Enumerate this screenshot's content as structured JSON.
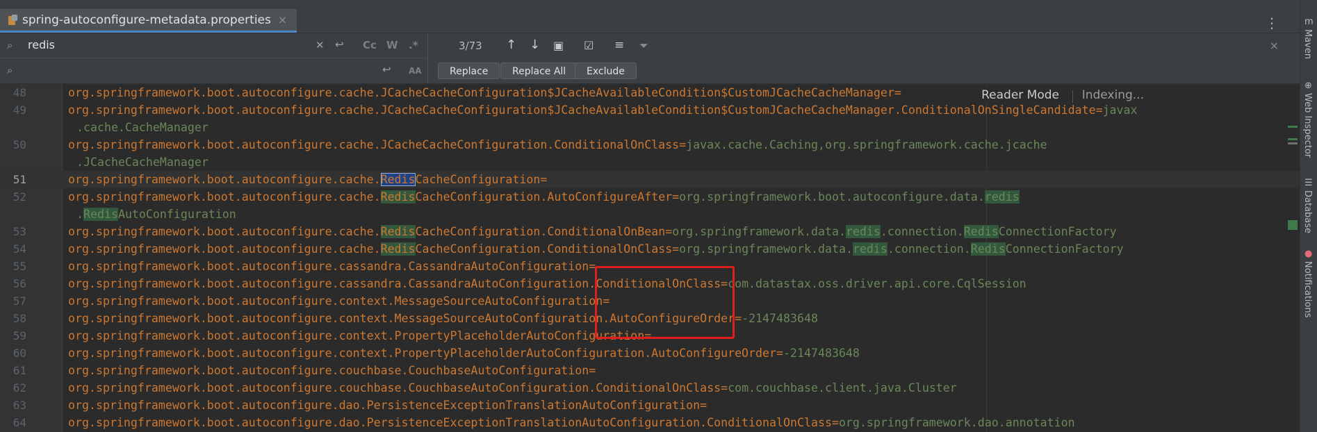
{
  "tab": {
    "title": "spring-autoconfigure-metadata.properties",
    "close": "×"
  },
  "tab_more": "⋮",
  "find": {
    "search_value": "redis",
    "replace_value": "",
    "match_case_label": "Cc",
    "words_label": "W",
    "regex_label": ".*",
    "preserve_case_label": "AA",
    "count": "3/73",
    "replace_label": "Replace",
    "replace_all_label": "Replace All",
    "exclude_label": "Exclude",
    "close": "×"
  },
  "editor": {
    "reader_mode_label": "Reader Mode",
    "indexing_label": "Indexing...",
    "lines": [
      {
        "num": "48"
      },
      {
        "num": "49"
      },
      {
        "num": ""
      },
      {
        "num": "50"
      },
      {
        "num": ""
      },
      {
        "num": "51"
      },
      {
        "num": "52"
      },
      {
        "num": ""
      },
      {
        "num": "53"
      },
      {
        "num": "54"
      },
      {
        "num": "55"
      },
      {
        "num": "56"
      },
      {
        "num": "57"
      },
      {
        "num": "58"
      },
      {
        "num": "59"
      },
      {
        "num": "60"
      },
      {
        "num": "61"
      },
      {
        "num": "62"
      },
      {
        "num": "63"
      },
      {
        "num": "64"
      }
    ]
  },
  "right_panels": [
    "Maven",
    "Web Inspector",
    "Database",
    "Notifications"
  ],
  "colors": {
    "key": "#cc7832",
    "value": "#6a8759",
    "match_highlight": "#32593d",
    "selected_match": "#214283",
    "annotation_box": "#e21d1d"
  }
}
